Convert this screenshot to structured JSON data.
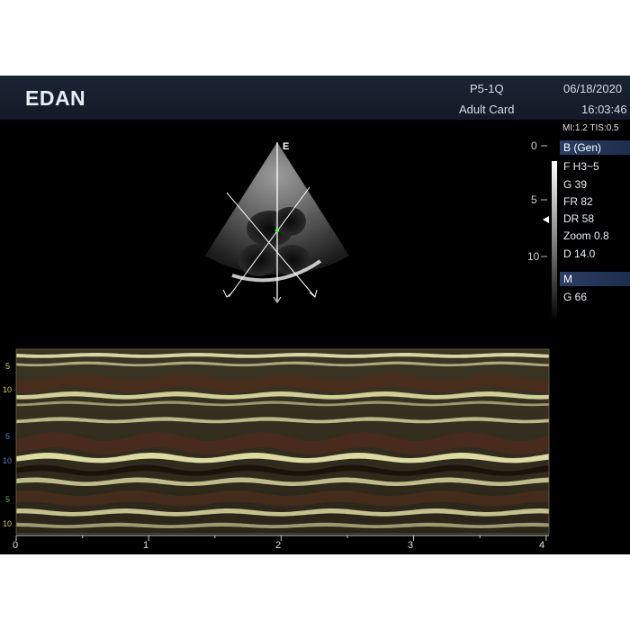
{
  "header": {
    "logo": "EDAN",
    "probe": "P5-1Q",
    "preset": "Adult Card",
    "date": "06/18/2020",
    "time": "16:03:46"
  },
  "status": {
    "mi_tis": "MI:1.2   TIS:0.5"
  },
  "b_mode": {
    "orientation_marker": "E",
    "depth_ticks": [
      "0",
      "5",
      "10"
    ],
    "panel_title": "B (Gen)",
    "params": [
      "F H3~5",
      "G 39",
      "FR 82",
      "DR 58",
      "Zoom 0.8",
      "D 14.0"
    ]
  },
  "m_mode": {
    "panel_title": "M",
    "params": [
      "G 66"
    ],
    "time_ticks": [
      "0",
      "1",
      "2",
      "3",
      "4"
    ],
    "left_ticks": [
      {
        "label": "5",
        "color": "#d8d24a"
      },
      {
        "label": "10",
        "color": "#d8d24a"
      },
      {
        "label": "5",
        "color": "#5b7fd8"
      },
      {
        "label": "10",
        "color": "#5b7fd8"
      },
      {
        "label": "5",
        "color": "#4fbf55"
      },
      {
        "label": "10",
        "color": "#d8d24a"
      }
    ]
  },
  "colors": {
    "header_bg": "#162030",
    "panel_accent": "#2a3f66",
    "mmode_tint": "#c8c47a"
  }
}
